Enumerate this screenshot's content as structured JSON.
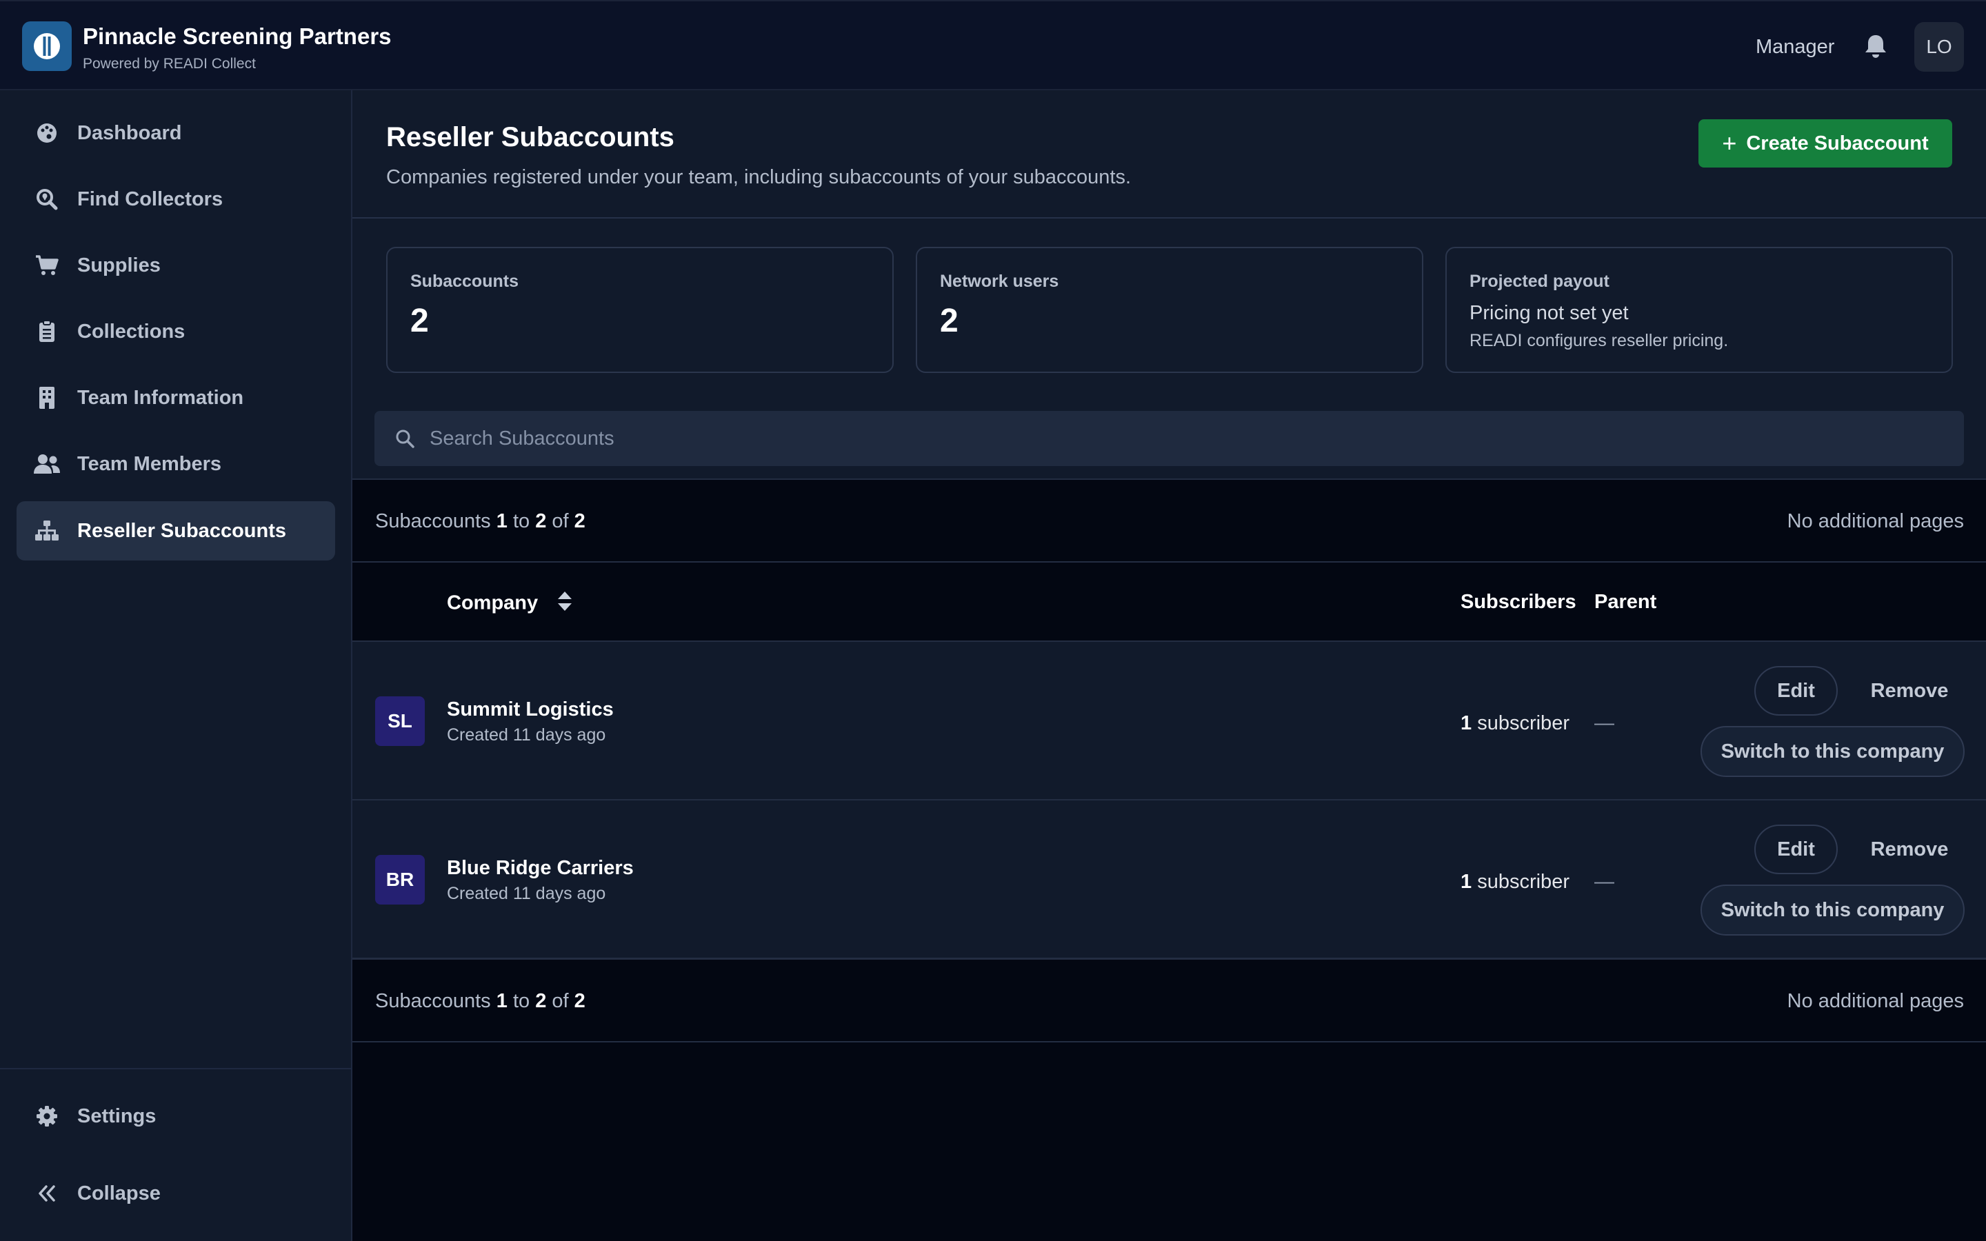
{
  "app": {
    "title": "Pinnacle Screening Partners",
    "subtitle": "Powered by READI Collect",
    "role": "Manager",
    "user_initials": "LO",
    "brand_color": "#1f5f96"
  },
  "sidebar": {
    "items": [
      {
        "label": "Dashboard",
        "icon": "palette-icon"
      },
      {
        "label": "Find Collectors",
        "icon": "search-location-icon"
      },
      {
        "label": "Supplies",
        "icon": "cart-icon"
      },
      {
        "label": "Collections",
        "icon": "clipboard-icon"
      },
      {
        "label": "Team Information",
        "icon": "building-icon"
      },
      {
        "label": "Team Members",
        "icon": "users-icon"
      },
      {
        "label": "Reseller Subaccounts",
        "icon": "sitemap-icon",
        "active": true
      }
    ],
    "settings_label": "Settings",
    "collapse_label": "Collapse"
  },
  "page": {
    "title": "Reseller Subaccounts",
    "subtitle": "Companies registered under your team, including subaccounts of your subaccounts.",
    "create_button": "Create Subaccount",
    "create_button_color": "#15803d"
  },
  "stats": {
    "subaccounts_label": "Subaccounts",
    "subaccounts_value": "2",
    "network_users_label": "Network users",
    "network_users_value": "2",
    "payout_label": "Projected payout",
    "payout_value": "Pricing not set yet",
    "payout_note": "READI configures reseller pricing."
  },
  "search": {
    "placeholder": "Search Subaccounts"
  },
  "pagination": {
    "prefix": "Subaccounts",
    "from": "1",
    "to_word": "to",
    "to": "2",
    "of_word": "of",
    "total": "2",
    "pages_note": "No additional pages"
  },
  "table": {
    "columns": {
      "company": "Company",
      "subscribers": "Subscribers",
      "parent": "Parent"
    },
    "rows": [
      {
        "initials": "SL",
        "name": "Summit Logistics",
        "created": "Created 11 days ago",
        "subscriber_count": "1",
        "subscriber_word": "subscriber",
        "parent": "—",
        "edit": "Edit",
        "remove": "Remove",
        "switch": "Switch to this company"
      },
      {
        "initials": "BR",
        "name": "Blue Ridge Carriers",
        "created": "Created 11 days ago",
        "subscriber_count": "1",
        "subscriber_word": "subscriber",
        "parent": "—",
        "edit": "Edit",
        "remove": "Remove",
        "switch": "Switch to this company"
      }
    ]
  }
}
